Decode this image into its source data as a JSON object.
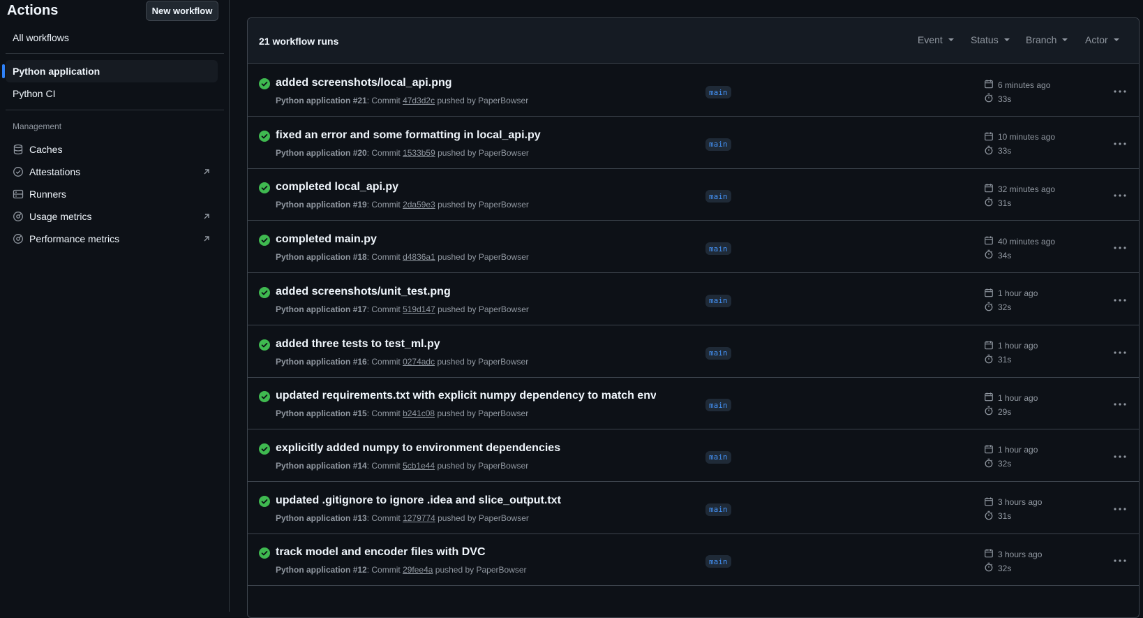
{
  "sidebar": {
    "title": "Actions",
    "new_workflow": "New workflow",
    "all_workflows": "All workflows",
    "workflows": [
      {
        "label": "Python application",
        "active": true
      },
      {
        "label": "Python CI",
        "active": false
      }
    ],
    "management_label": "Management",
    "management": [
      {
        "label": "Caches",
        "icon": "database-icon",
        "external": false
      },
      {
        "label": "Attestations",
        "icon": "verified-icon",
        "external": true
      },
      {
        "label": "Runners",
        "icon": "server-icon",
        "external": false
      },
      {
        "label": "Usage metrics",
        "icon": "meter-icon",
        "external": true
      },
      {
        "label": "Performance metrics",
        "icon": "meter-icon",
        "external": true
      }
    ]
  },
  "main": {
    "runs_count": "21 workflow runs",
    "filters": [
      "Event",
      "Status",
      "Branch",
      "Actor"
    ],
    "runs": [
      {
        "title": "added screenshots/local_api.png",
        "workflow": "Python application",
        "number": "#21",
        "sha": "47d3d2c",
        "actor": "PaperBowser",
        "branch": "main",
        "time": "6 minutes ago",
        "duration": "33s"
      },
      {
        "title": "fixed an error and some formatting in local_api.py",
        "workflow": "Python application",
        "number": "#20",
        "sha": "1533b59",
        "actor": "PaperBowser",
        "branch": "main",
        "time": "10 minutes ago",
        "duration": "33s"
      },
      {
        "title": "completed local_api.py",
        "workflow": "Python application",
        "number": "#19",
        "sha": "2da59e3",
        "actor": "PaperBowser",
        "branch": "main",
        "time": "32 minutes ago",
        "duration": "31s"
      },
      {
        "title": "completed main.py",
        "workflow": "Python application",
        "number": "#18",
        "sha": "d4836a1",
        "actor": "PaperBowser",
        "branch": "main",
        "time": "40 minutes ago",
        "duration": "34s"
      },
      {
        "title": "added screenshots/unit_test.png",
        "workflow": "Python application",
        "number": "#17",
        "sha": "519d147",
        "actor": "PaperBowser",
        "branch": "main",
        "time": "1 hour ago",
        "duration": "32s"
      },
      {
        "title": "added three tests to test_ml.py",
        "workflow": "Python application",
        "number": "#16",
        "sha": "0274adc",
        "actor": "PaperBowser",
        "branch": "main",
        "time": "1 hour ago",
        "duration": "31s"
      },
      {
        "title": "updated requirements.txt with explicit numpy dependency to match envi...",
        "workflow": "Python application",
        "number": "#15",
        "sha": "b241c08",
        "actor": "PaperBowser",
        "branch": "main",
        "time": "1 hour ago",
        "duration": "29s"
      },
      {
        "title": "explicitly added numpy to environment dependencies",
        "workflow": "Python application",
        "number": "#14",
        "sha": "5cb1e44",
        "actor": "PaperBowser",
        "branch": "main",
        "time": "1 hour ago",
        "duration": "32s"
      },
      {
        "title": "updated .gitignore to ignore .idea and slice_output.txt",
        "workflow": "Python application",
        "number": "#13",
        "sha": "1279774",
        "actor": "PaperBowser",
        "branch": "main",
        "time": "3 hours ago",
        "duration": "31s"
      },
      {
        "title": "track model and encoder files with DVC",
        "workflow": "Python application",
        "number": "#12",
        "sha": "29fee4a",
        "actor": "PaperBowser",
        "branch": "main",
        "time": "3 hours ago",
        "duration": "32s"
      }
    ]
  },
  "colors": {
    "success": "#3fb950",
    "accent": "#2f81f7",
    "branch_text": "#4493f8"
  }
}
